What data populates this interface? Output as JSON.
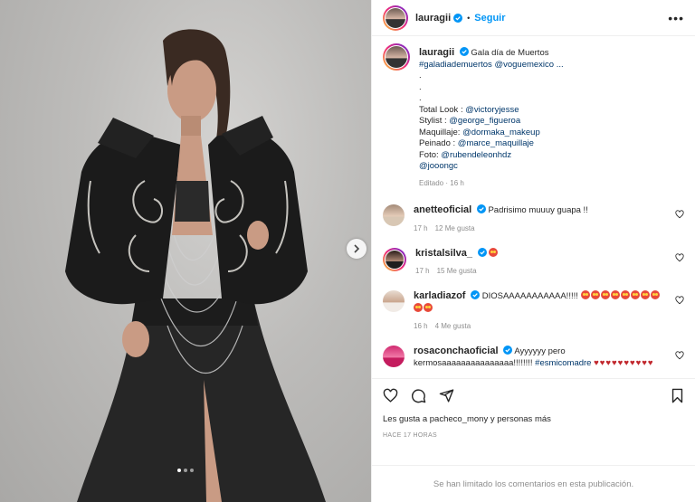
{
  "header": {
    "username": "lauragii",
    "separator": "•",
    "follow_label": "Seguir",
    "more_label": "•••"
  },
  "caption": {
    "username": "lauragii",
    "line1": "Gala día de Muertos",
    "hashtags": "#galadiademuertos @voguemexico ...",
    "dot1": ".",
    "dot2": ".",
    "dot3": ".",
    "credits": [
      {
        "label": "Total Look : ",
        "handle": "@victoryjesse"
      },
      {
        "label": "Stylist : ",
        "handle": "@george_figueroa"
      },
      {
        "label": "Maquillaje: ",
        "handle": "@dormaka_makeup"
      },
      {
        "label": "Peinado : ",
        "handle": "@marce_maquillaje"
      },
      {
        "label": "Foto: ",
        "handle": "@rubendeleonhdz"
      },
      {
        "label": "",
        "handle": "@jooongc"
      }
    ],
    "edited": "Editado · 16 h"
  },
  "comments": [
    {
      "user": "anetteoficial",
      "text": "Padrisimo muuuy guapa !!",
      "time": "17 h",
      "likes": "12 Me gusta"
    },
    {
      "user": "kristalsilva_",
      "text": "",
      "time": "17 h",
      "likes": "15 Me gusta"
    },
    {
      "user": "karladiazof",
      "text": "DIOSAAAAAAAAAAA!!!!!",
      "time": "16 h",
      "likes": "4 Me gusta"
    },
    {
      "user": "rosaconchaoficial",
      "text": "Ayyyyyy pero kermosaaaaaaaaaaaaaaa!!!!!!!! ",
      "tag": "#esmicomadre",
      "hearts": "♥♥♥♥♥♥♥♥♥♥"
    }
  ],
  "footer": {
    "likes_text": "Les gusta a pacheco_mony y personas más",
    "time_ago": "HACE 17 HORAS",
    "comments_limited": "Se han limitado los comentarios en esta publicación."
  },
  "colors": {
    "link": "#00376b",
    "follow": "#0095f6",
    "verified": "#0095f6",
    "muted": "#8e8e8e"
  },
  "icons": [
    "verified-badge-icon",
    "more-options-icon",
    "heart-icon",
    "comment-icon",
    "share-icon",
    "save-icon",
    "chevron-right-icon"
  ]
}
